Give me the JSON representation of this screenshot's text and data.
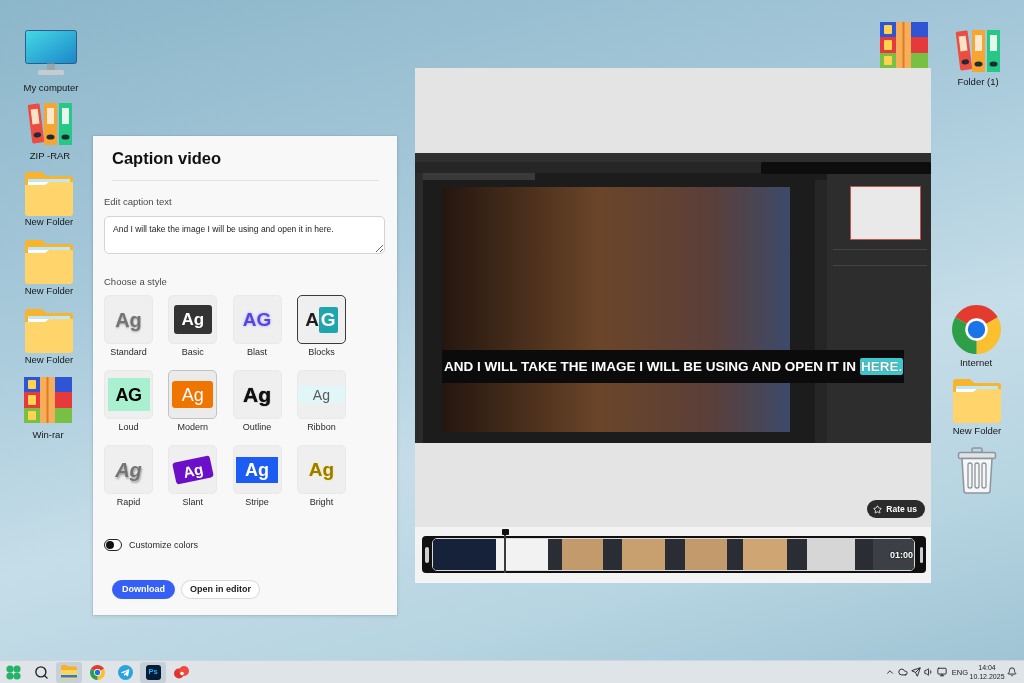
{
  "desktop_icons": [
    {
      "kind": "computer",
      "label": "My computer"
    },
    {
      "kind": "binders",
      "label": "ZIP -RAR"
    },
    {
      "kind": "folder",
      "label": "New Folder"
    },
    {
      "kind": "folder",
      "label": "New Folder"
    },
    {
      "kind": "folder",
      "label": "New Folder"
    },
    {
      "kind": "archive",
      "label": "Win-rar"
    }
  ],
  "caption_panel": {
    "title": "Caption video",
    "caption_label": "Edit caption text",
    "caption_text": "And I will take the image I will be using and open it in here.",
    "style_label": "Choose a style",
    "styles": [
      {
        "name": "Standard",
        "kind": "standard",
        "sample": "Ag",
        "selected": false,
        "hovered": false
      },
      {
        "name": "Basic",
        "kind": "basic",
        "sample": "Ag",
        "selected": false,
        "hovered": false
      },
      {
        "name": "Blast",
        "kind": "blast",
        "sample": "AG",
        "selected": false,
        "hovered": false
      },
      {
        "name": "Blocks",
        "kind": "blocks",
        "sample": "A",
        "accent": "G",
        "selected": true,
        "hovered": false
      },
      {
        "name": "Loud",
        "kind": "loud",
        "sample": "AG",
        "selected": false,
        "hovered": false
      },
      {
        "name": "Modern",
        "kind": "modern",
        "sample": "Ag",
        "selected": false,
        "hovered": true
      },
      {
        "name": "Outline",
        "kind": "outline",
        "sample": "Ag",
        "selected": false,
        "hovered": false
      },
      {
        "name": "Ribbon",
        "kind": "ribbon",
        "sample": "Ag",
        "selected": false,
        "hovered": false
      },
      {
        "name": "Rapid",
        "kind": "rapid",
        "sample": "Ag",
        "selected": false,
        "hovered": false
      },
      {
        "name": "Slant",
        "kind": "slant",
        "sample": "Ag",
        "selected": false,
        "hovered": false
      },
      {
        "name": "Stripe",
        "kind": "stripe",
        "sample": "Ag",
        "selected": false,
        "hovered": false
      },
      {
        "name": "Bright",
        "kind": "bright",
        "sample": "Ag",
        "selected": false,
        "hovered": false
      }
    ],
    "customize_colors": {
      "label": "Customize colors",
      "on": false
    },
    "buttons": [
      {
        "kind": "primary",
        "label": "Download"
      },
      {
        "kind": "secondary",
        "label": "Open in editor"
      }
    ]
  },
  "preview": {
    "caption": {
      "text": "AND I WILL TAKE THE IMAGE I WILL BE USING AND OPEN IT IN",
      "highlight": "HERE."
    },
    "rate_button": {
      "label": "Rate us"
    },
    "timeline": {
      "duration": "01:00"
    }
  },
  "desktop_icons_right": [
    {
      "kind": "archive"
    },
    {
      "kind": "binders",
      "label": "Folder (1)"
    },
    {
      "kind": "browser",
      "label": "Internet"
    },
    {
      "kind": "folder",
      "label": "New Folder"
    },
    {
      "kind": "trash"
    }
  ],
  "taskbar": {
    "apps": [
      {
        "kind": "start",
        "open": false
      },
      {
        "kind": "search",
        "open": false
      },
      {
        "kind": "explorer",
        "open": true
      },
      {
        "kind": "browser",
        "open": false
      },
      {
        "kind": "telegram",
        "open": false
      },
      {
        "kind": "photoshop",
        "glyph": "Ps",
        "open": true
      },
      {
        "kind": "circles",
        "open": false
      }
    ],
    "tray": [
      {
        "kind": "chevron"
      },
      {
        "kind": "cloud"
      },
      {
        "kind": "telegram"
      },
      {
        "kind": "speaker"
      },
      {
        "kind": "display"
      }
    ],
    "language": "ENG",
    "time": "14:04",
    "date": "10.12.2025"
  }
}
